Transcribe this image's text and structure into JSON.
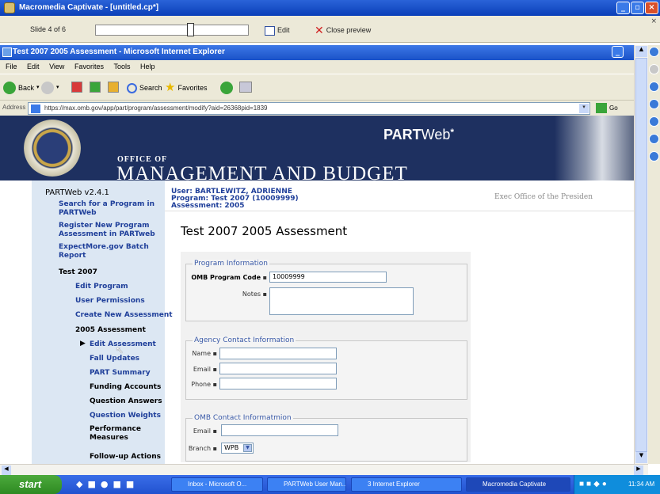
{
  "captivate": {
    "window_title": "Macromedia Captivate - [untitled.cp*]",
    "slide_label": "Slide 4 of 6",
    "edit_label": "Edit",
    "close_preview_label": "Close preview"
  },
  "ie": {
    "window_title": "Test 2007 2005 Assessment - Microsoft Internet Explorer",
    "menu": [
      "File",
      "Edit",
      "View",
      "Favorites",
      "Tools",
      "Help"
    ],
    "toolbar": {
      "back": "Back",
      "search": "Search",
      "favorites": "Favorites"
    },
    "address_label": "Address",
    "url": "https://max.omb.gov/app/part/program/assessment/modify?aid=26368pid=1839",
    "go_label": "Go"
  },
  "banner": {
    "office_of": "OFFICE OF",
    "agency": "MANAGEMENT AND BUDGET",
    "brand_bold": "PART",
    "brand_light": "Web"
  },
  "nav": {
    "version": "PARTWeb v2.4.1",
    "search_link": "Search for a Program in PARTWeb",
    "register_link": "Register New Program Assessment in PARTweb",
    "expectmore_link": "ExpectMore.gov Batch Report",
    "program": "Test 2007",
    "edit_program": "Edit Program",
    "user_permissions": "User Permissions",
    "create_assessment": "Create New Assessment",
    "assessment_year": "2005 Assessment",
    "edit_assessment": "Edit Assessment",
    "fall_updates": "Fall Updates",
    "part_summary": "PART Summary",
    "funding_accounts": "Funding Accounts",
    "question_answers": "Question Answers",
    "question_weights": "Question Weights",
    "performance_measures": "Performance Measures",
    "followup_actions": "Follow-up Actions"
  },
  "user": {
    "user_line": "User: BARTLEWITZ, ADRIENNE",
    "program_line": "Program: Test 2007 (10009999)",
    "assessment_line": "Assessment: 2005",
    "exec_office": "Exec Office of the Presiden"
  },
  "main": {
    "page_title": "Test 2007 2005 Assessment",
    "program_info": {
      "legend": "Program Information",
      "code_label": "OMB Program Code",
      "code_value": "10009999",
      "notes_label": "Notes"
    },
    "agency_contact": {
      "legend": "Agency Contact Information",
      "name_label": "Name",
      "email_label": "Email",
      "phone_label": "Phone"
    },
    "omb_contact": {
      "legend": "OMB Contact Informatmion",
      "email_label": "Email",
      "branch_label": "Branch",
      "branch_value": "WPB"
    }
  },
  "taskbar": {
    "start": "start",
    "tasks": [
      "Inbox - Microsoft O...",
      "PARTWeb User Man...",
      "3 Internet Explorer",
      "Macromedia Captivate"
    ],
    "clock": "11:34 AM"
  }
}
